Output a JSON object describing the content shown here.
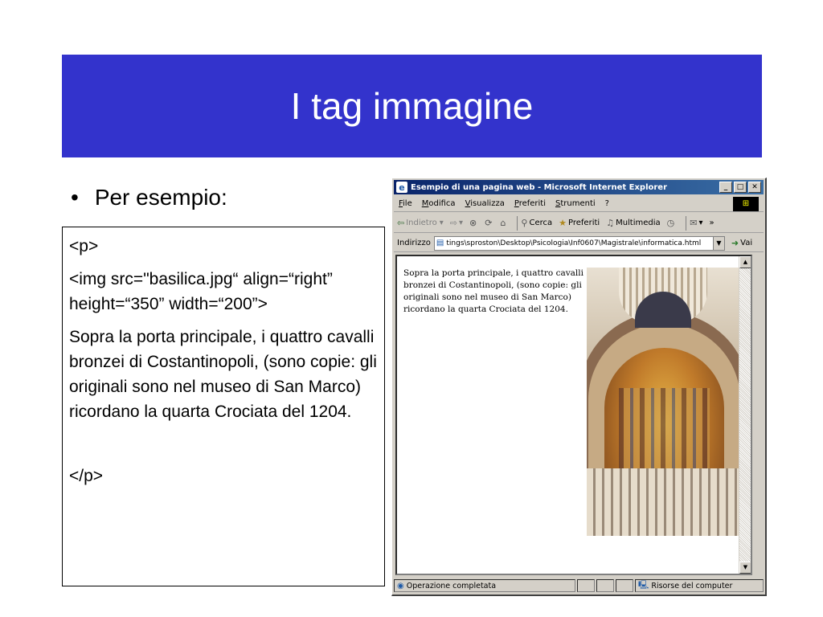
{
  "slide": {
    "title": "I tag immagine",
    "bullet_symbol": "•",
    "bullet_text": "Per esempio:",
    "code_lines": [
      "<p>",
      "<img src=\"basilica.jpg“ align=“right” height=“350” width=“200”>",
      "Sopra la porta principale, i quattro cavalli bronzei di Costantinopoli, (sono copie: gli originali sono nel museo di San Marco) ricordano la quarta Crociata del 1204.",
      "</p>"
    ]
  },
  "browser": {
    "window_title": "Esempio di una pagina web - Microsoft Internet Explorer",
    "window_buttons": {
      "minimize": "_",
      "maximize": "□",
      "close": "✕"
    },
    "menu": [
      "File",
      "Modifica",
      "Visualizza",
      "Preferiti",
      "Strumenti",
      "?"
    ],
    "toolbar": {
      "back": "Indietro",
      "search": "Cerca",
      "favorites": "Preferiti",
      "media": "Multimedia"
    },
    "address": {
      "label": "Indirizzo",
      "value": "tings\\sproston\\Desktop\\Psicologia\\Inf0607\\Magistrale\\informatica.html",
      "go_label": "Vai"
    },
    "page_text": "Sopra la porta principale, i quattro cavalli bronzei di Costantinopoli, (sono copie: gli originali sono nel museo di San Marco) ricordano la quarta Crociata del 1204.",
    "status": {
      "text": "Operazione completata",
      "zone": "Risorse del computer"
    }
  }
}
